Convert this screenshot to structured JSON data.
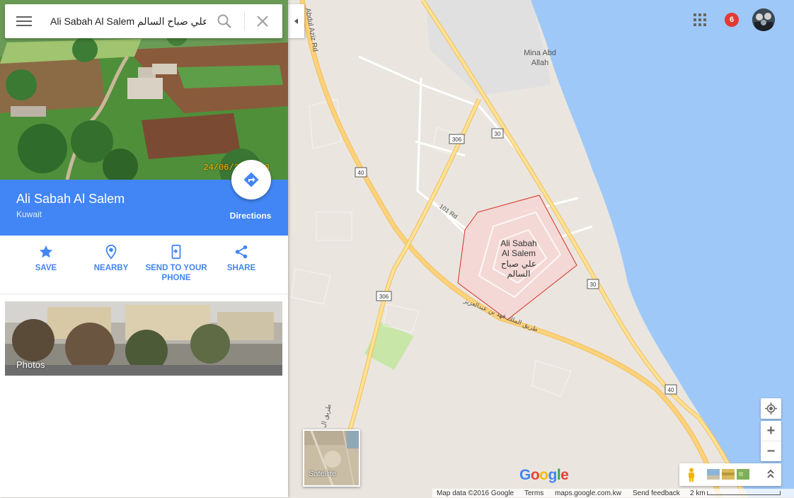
{
  "search": {
    "value": "Ali Sabah Al Salem علي صباح السالم"
  },
  "place": {
    "name": "Ali Sabah Al Salem",
    "region": "Kuwait",
    "directions_label": "Directions",
    "photo_date": "24/06/2012 13"
  },
  "actions": [
    {
      "label": "SAVE",
      "icon": "star-icon"
    },
    {
      "label": "NEARBY",
      "icon": "nearby-icon"
    },
    {
      "label": "SEND TO YOUR PHONE",
      "icon": "send-to-phone-icon"
    },
    {
      "label": "SHARE",
      "icon": "share-icon"
    }
  ],
  "photos_label": "Photos",
  "header": {
    "notifications_count": "6"
  },
  "map": {
    "area_label_en_1": "Ali Sabah",
    "area_label_en_2": "Al Salem",
    "area_label_ar_1": "علي صباح",
    "area_label_ar_2": "السالم",
    "mina_1": "Mina Abd",
    "mina_2": "Allah",
    "road_abdulaziz": "Abdul Aziz Rd",
    "road_101": "101 Rd",
    "road_king_fahd_ar": "طريق الملك فهد بن عبدالعزيز",
    "road_tariq_ar": "طريق ال",
    "shields": {
      "s306a": "306",
      "s30a": "30",
      "s40a": "40",
      "s30b": "30",
      "s306b": "306",
      "s40b": "40"
    },
    "satellite_label": "Satellite",
    "google_logo": "Google"
  },
  "footer": {
    "map_data": "Map data ©2016 Google",
    "terms": "Terms",
    "domain": "maps.google.com.kw",
    "feedback": "Send feedback",
    "scale": "2 km"
  },
  "colors": {
    "accent": "#4285f4",
    "water": "#9ec8f8",
    "land": "#eae6df",
    "highway": "#fdd27b",
    "area_fill": "#f5d5d3",
    "area_border": "#d93025"
  }
}
